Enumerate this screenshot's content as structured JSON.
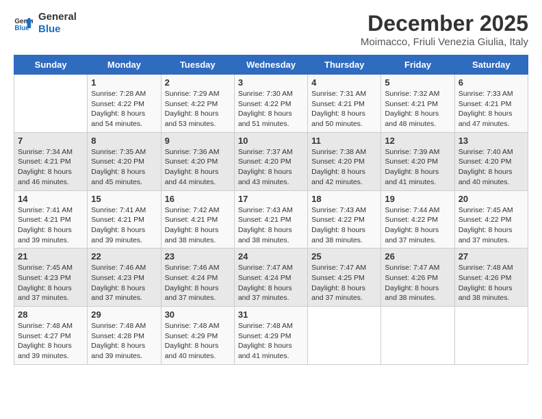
{
  "logo": {
    "line1": "General",
    "line2": "Blue"
  },
  "title": "December 2025",
  "location": "Moimacco, Friuli Venezia Giulia, Italy",
  "days_of_week": [
    "Sunday",
    "Monday",
    "Tuesday",
    "Wednesday",
    "Thursday",
    "Friday",
    "Saturday"
  ],
  "weeks": [
    [
      {
        "day": "",
        "info": ""
      },
      {
        "day": "1",
        "info": "Sunrise: 7:28 AM\nSunset: 4:22 PM\nDaylight: 8 hours\nand 54 minutes."
      },
      {
        "day": "2",
        "info": "Sunrise: 7:29 AM\nSunset: 4:22 PM\nDaylight: 8 hours\nand 53 minutes."
      },
      {
        "day": "3",
        "info": "Sunrise: 7:30 AM\nSunset: 4:22 PM\nDaylight: 8 hours\nand 51 minutes."
      },
      {
        "day": "4",
        "info": "Sunrise: 7:31 AM\nSunset: 4:21 PM\nDaylight: 8 hours\nand 50 minutes."
      },
      {
        "day": "5",
        "info": "Sunrise: 7:32 AM\nSunset: 4:21 PM\nDaylight: 8 hours\nand 48 minutes."
      },
      {
        "day": "6",
        "info": "Sunrise: 7:33 AM\nSunset: 4:21 PM\nDaylight: 8 hours\nand 47 minutes."
      }
    ],
    [
      {
        "day": "7",
        "info": "Sunrise: 7:34 AM\nSunset: 4:21 PM\nDaylight: 8 hours\nand 46 minutes."
      },
      {
        "day": "8",
        "info": "Sunrise: 7:35 AM\nSunset: 4:20 PM\nDaylight: 8 hours\nand 45 minutes."
      },
      {
        "day": "9",
        "info": "Sunrise: 7:36 AM\nSunset: 4:20 PM\nDaylight: 8 hours\nand 44 minutes."
      },
      {
        "day": "10",
        "info": "Sunrise: 7:37 AM\nSunset: 4:20 PM\nDaylight: 8 hours\nand 43 minutes."
      },
      {
        "day": "11",
        "info": "Sunrise: 7:38 AM\nSunset: 4:20 PM\nDaylight: 8 hours\nand 42 minutes."
      },
      {
        "day": "12",
        "info": "Sunrise: 7:39 AM\nSunset: 4:20 PM\nDaylight: 8 hours\nand 41 minutes."
      },
      {
        "day": "13",
        "info": "Sunrise: 7:40 AM\nSunset: 4:20 PM\nDaylight: 8 hours\nand 40 minutes."
      }
    ],
    [
      {
        "day": "14",
        "info": "Sunrise: 7:41 AM\nSunset: 4:21 PM\nDaylight: 8 hours\nand 39 minutes."
      },
      {
        "day": "15",
        "info": "Sunrise: 7:41 AM\nSunset: 4:21 PM\nDaylight: 8 hours\nand 39 minutes."
      },
      {
        "day": "16",
        "info": "Sunrise: 7:42 AM\nSunset: 4:21 PM\nDaylight: 8 hours\nand 38 minutes."
      },
      {
        "day": "17",
        "info": "Sunrise: 7:43 AM\nSunset: 4:21 PM\nDaylight: 8 hours\nand 38 minutes."
      },
      {
        "day": "18",
        "info": "Sunrise: 7:43 AM\nSunset: 4:22 PM\nDaylight: 8 hours\nand 38 minutes."
      },
      {
        "day": "19",
        "info": "Sunrise: 7:44 AM\nSunset: 4:22 PM\nDaylight: 8 hours\nand 37 minutes."
      },
      {
        "day": "20",
        "info": "Sunrise: 7:45 AM\nSunset: 4:22 PM\nDaylight: 8 hours\nand 37 minutes."
      }
    ],
    [
      {
        "day": "21",
        "info": "Sunrise: 7:45 AM\nSunset: 4:23 PM\nDaylight: 8 hours\nand 37 minutes."
      },
      {
        "day": "22",
        "info": "Sunrise: 7:46 AM\nSunset: 4:23 PM\nDaylight: 8 hours\nand 37 minutes."
      },
      {
        "day": "23",
        "info": "Sunrise: 7:46 AM\nSunset: 4:24 PM\nDaylight: 8 hours\nand 37 minutes."
      },
      {
        "day": "24",
        "info": "Sunrise: 7:47 AM\nSunset: 4:24 PM\nDaylight: 8 hours\nand 37 minutes."
      },
      {
        "day": "25",
        "info": "Sunrise: 7:47 AM\nSunset: 4:25 PM\nDaylight: 8 hours\nand 37 minutes."
      },
      {
        "day": "26",
        "info": "Sunrise: 7:47 AM\nSunset: 4:26 PM\nDaylight: 8 hours\nand 38 minutes."
      },
      {
        "day": "27",
        "info": "Sunrise: 7:48 AM\nSunset: 4:26 PM\nDaylight: 8 hours\nand 38 minutes."
      }
    ],
    [
      {
        "day": "28",
        "info": "Sunrise: 7:48 AM\nSunset: 4:27 PM\nDaylight: 8 hours\nand 39 minutes."
      },
      {
        "day": "29",
        "info": "Sunrise: 7:48 AM\nSunset: 4:28 PM\nDaylight: 8 hours\nand 39 minutes."
      },
      {
        "day": "30",
        "info": "Sunrise: 7:48 AM\nSunset: 4:29 PM\nDaylight: 8 hours\nand 40 minutes."
      },
      {
        "day": "31",
        "info": "Sunrise: 7:48 AM\nSunset: 4:29 PM\nDaylight: 8 hours\nand 41 minutes."
      },
      {
        "day": "",
        "info": ""
      },
      {
        "day": "",
        "info": ""
      },
      {
        "day": "",
        "info": ""
      }
    ]
  ]
}
